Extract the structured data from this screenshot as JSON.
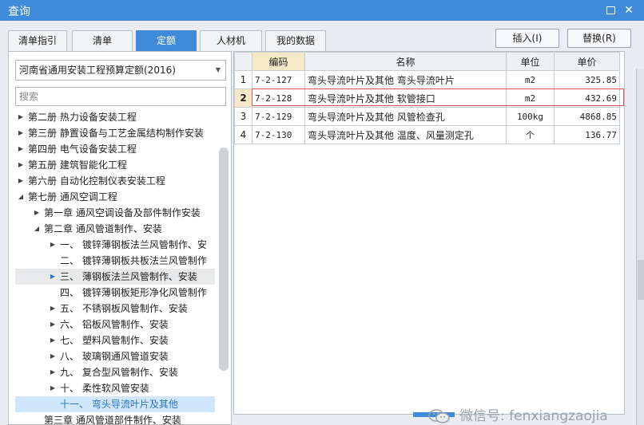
{
  "window": {
    "title": "查询"
  },
  "tabs": [
    {
      "label": "清单指引",
      "active": false
    },
    {
      "label": "清单",
      "active": false
    },
    {
      "label": "定额",
      "active": true
    },
    {
      "label": "人材机",
      "active": false
    },
    {
      "label": "我的数据",
      "active": false
    }
  ],
  "actions": {
    "insert_label": "插入(I)",
    "replace_label": "替换(R)"
  },
  "left": {
    "quota_library": "河南省通用安装工程预算定额(2016)",
    "search_placeholder": "搜索",
    "tree": [
      {
        "label": "第二册  热力设备安装工程",
        "expander": "collapsed"
      },
      {
        "label": "第三册  静置设备与工艺金属结构制作安装",
        "expander": "collapsed"
      },
      {
        "label": "第四册  电气设备安装工程",
        "expander": "collapsed"
      },
      {
        "label": "第五册  建筑智能化工程",
        "expander": "collapsed"
      },
      {
        "label": "第六册  自动化控制仪表安装工程",
        "expander": "collapsed"
      },
      {
        "label": "第七册  通风空调工程",
        "expander": "expanded"
      },
      {
        "label": "第一章  通风空调设备及部件制作安装",
        "expander": "collapsed"
      },
      {
        "label": "第二章  通风管道制作、安装",
        "expander": "expanded"
      },
      {
        "label": "一、  镀锌薄钢板法兰风管制作、安",
        "expander": "collapsed"
      },
      {
        "label": "二、  镀锌薄钢板共板法兰风管制作",
        "expander": "none"
      },
      {
        "label": "三、  薄钢板法兰风管制作、安装",
        "expander": "collapsed"
      },
      {
        "label": "四、  镀锌薄钢板矩形净化风管制作",
        "expander": "none"
      },
      {
        "label": "五、  不锈钢板风管制作、安装",
        "expander": "collapsed"
      },
      {
        "label": "六、  铝板风管制作、安装",
        "expander": "collapsed"
      },
      {
        "label": "七、  塑料风管制作、安装",
        "expander": "collapsed"
      },
      {
        "label": "八、  玻璃钢通风管道安装",
        "expander": "collapsed"
      },
      {
        "label": "九、  复合型风管制作、安装",
        "expander": "collapsed"
      },
      {
        "label": "十、  柔性软风管安装",
        "expander": "collapsed"
      },
      {
        "label": "十一、  弯头导流叶片及其他",
        "expander": "none"
      },
      {
        "label": "第三章  通风管道部件制作、安装",
        "expander": "collapsed"
      }
    ]
  },
  "grid": {
    "headers": {
      "code": "编码",
      "name": "名称",
      "unit": "单位",
      "price": "单价"
    },
    "rows": [
      {
        "n": "1",
        "code": "7-2-127",
        "name": "弯头导流叶片及其他 弯头导流叶片",
        "unit": "m2",
        "price": "325.85"
      },
      {
        "n": "2",
        "code": "7-2-128",
        "name": "弯头导流叶片及其他 软管接口",
        "unit": "m2",
        "price": "432.69"
      },
      {
        "n": "3",
        "code": "7-2-129",
        "name": "弯头导流叶片及其他 风管检查孔",
        "unit": "100kg",
        "price": "4868.85"
      },
      {
        "n": "4",
        "code": "7-2-130",
        "name": "弯头导流叶片及其他 温度、风量测定孔",
        "unit": "个",
        "price": "136.77"
      }
    ]
  },
  "watermark": {
    "text": "微信号: fenxiangzaojia"
  },
  "colors": {
    "accent": "#3f8bd9",
    "selection_outline": "#e05050",
    "tree_selected": "#cfe6fb"
  }
}
